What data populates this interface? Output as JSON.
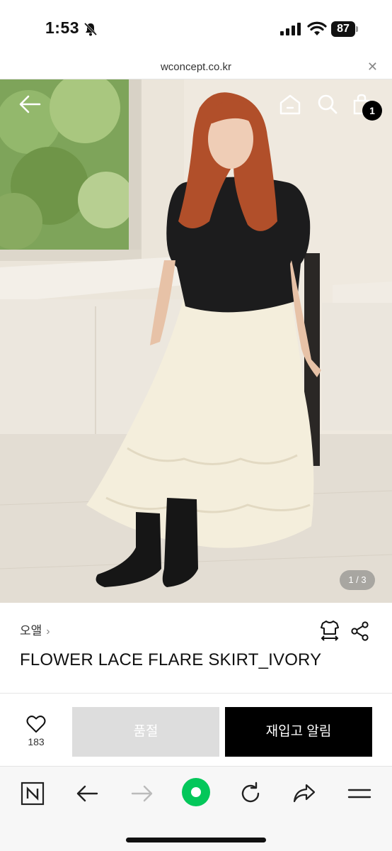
{
  "status_bar": {
    "time": "1:53",
    "battery": "87",
    "icons": [
      "bell-slash-icon",
      "signal-icon",
      "wifi-icon",
      "battery-icon"
    ]
  },
  "url_bar": {
    "url": "wconcept.co.kr",
    "close_icon": "close-icon"
  },
  "hero": {
    "cart_count": "1",
    "page_indicator": "1 / 3",
    "icons": [
      "back-arrow-icon",
      "home-icon",
      "search-icon",
      "shopping-bag-icon"
    ]
  },
  "product": {
    "brand": "오앨",
    "title": "FLOWER LACE FLARE SKIRT_IVORY",
    "icons": [
      "size-guide-icon",
      "share-icon"
    ]
  },
  "actions": {
    "like_count": "183",
    "soldout_label": "품절",
    "restock_label": "재입고 알림"
  },
  "toolbar": {
    "icons": [
      "naver-n-icon",
      "back-icon",
      "forward-icon",
      "green-dot-icon",
      "reload-icon",
      "share-arrow-icon",
      "menu-icon"
    ]
  },
  "colors": {
    "accent_green": "#03c75a",
    "primary_button": "#000000",
    "disabled_button": "#dddddd"
  }
}
